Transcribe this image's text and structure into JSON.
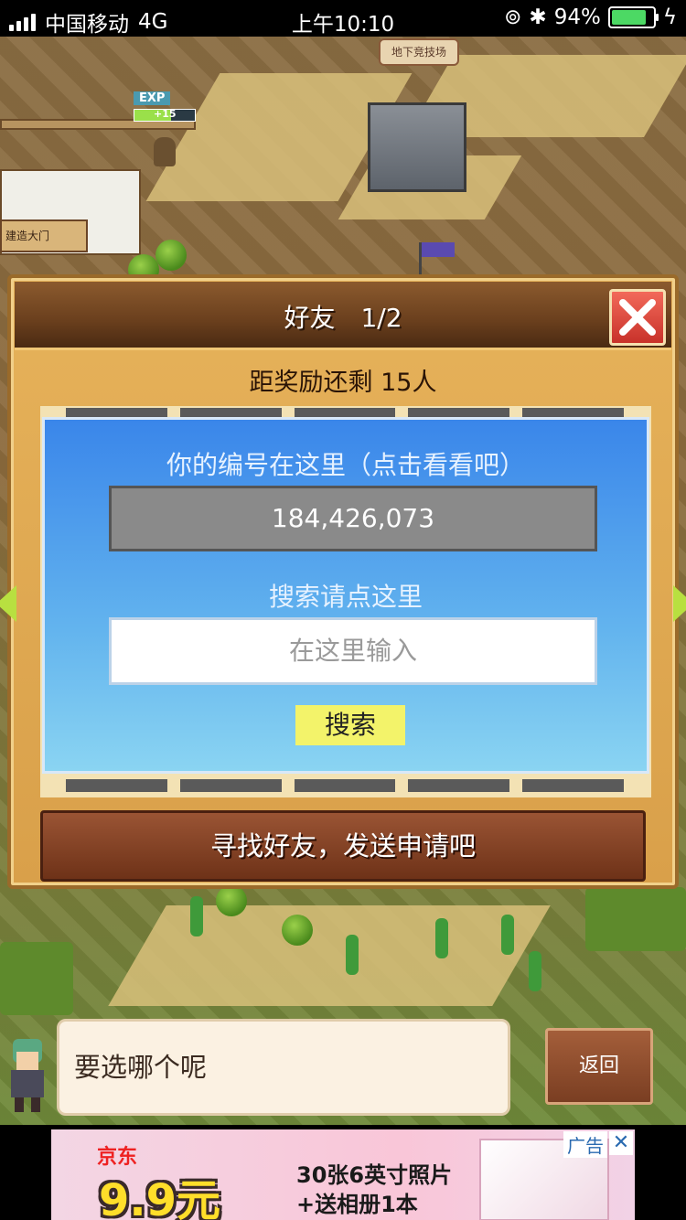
{
  "status_bar": {
    "carrier": "中国移动",
    "network": "4G",
    "time": "上午10:10",
    "battery": "94%",
    "battery_level": 0.94
  },
  "scene": {
    "arena_label": "地下竞技场",
    "gate_label": "建造大门",
    "exp_label": "EXP",
    "exp_value": "+15"
  },
  "dialog": {
    "title": "好友　1/2",
    "remaining": "距奖励还剩 15人",
    "id_hint": "你的编号在这里（点击看看吧）",
    "id_value": "184,426,073",
    "search_hint": "搜索请点这里",
    "search_placeholder": "在这里输入",
    "search_button": "搜索",
    "find_button": "寻找好友，发送申请吧"
  },
  "chat": {
    "message": "要选哪个呢",
    "back_button": "返回"
  },
  "ad": {
    "brand": "京东",
    "price": "9.9元",
    "line1": "30张6英寸照片",
    "line2": "+送相册1本",
    "tag": "广告",
    "close": "✕"
  },
  "colors": {
    "panel_blue": "#3a86ea",
    "search_button": "#f3f36a",
    "close_red": "#e04a3a",
    "find_button": "#8a4428"
  }
}
